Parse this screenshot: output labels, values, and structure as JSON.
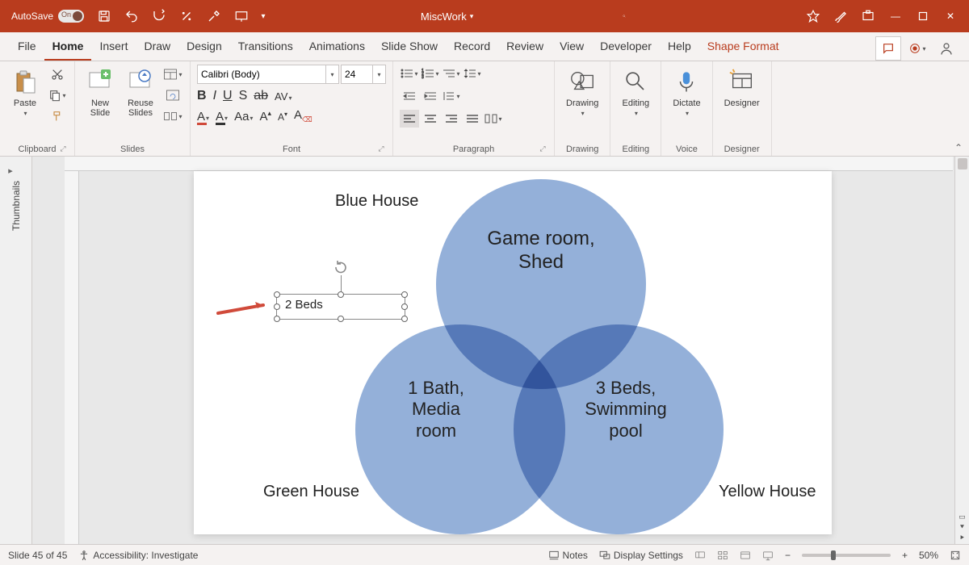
{
  "titlebar": {
    "autosave_label": "AutoSave",
    "autosave_state": "On",
    "doc_name": "MiscWork"
  },
  "tabs": {
    "file": "File",
    "home": "Home",
    "insert": "Insert",
    "draw": "Draw",
    "design": "Design",
    "transitions": "Transitions",
    "animations": "Animations",
    "slideshow": "Slide Show",
    "record": "Record",
    "review": "Review",
    "view": "View",
    "developer": "Developer",
    "help": "Help",
    "shape_format": "Shape Format"
  },
  "ribbon": {
    "clipboard": {
      "paste": "Paste",
      "label": "Clipboard"
    },
    "slides": {
      "new_slide": "New\nSlide",
      "reuse": "Reuse\nSlides",
      "label": "Slides"
    },
    "font": {
      "name": "Calibri (Body)",
      "size": "24",
      "label": "Font"
    },
    "paragraph": {
      "label": "Paragraph"
    },
    "drawing": {
      "btn": "Drawing",
      "label": "Drawing"
    },
    "editing": {
      "btn": "Editing",
      "label": "Editing"
    },
    "voice": {
      "btn": "Dictate",
      "label": "Voice"
    },
    "designer": {
      "btn": "Designer",
      "label": "Designer"
    }
  },
  "thumbnails_label": "Thumbnails",
  "chart_data": {
    "type": "venn",
    "sets": [
      {
        "name": "Blue House",
        "items": [
          "Game room",
          "Shed"
        ]
      },
      {
        "name": "Green House",
        "items": [
          "1 Bath",
          "Media room"
        ]
      },
      {
        "name": "Yellow House",
        "items": [
          "3 Beds",
          "Swimming pool"
        ]
      }
    ],
    "labels": {
      "top": "Game room,\nShed",
      "left": "1 Bath,\nMedia\nroom",
      "right": "3 Beds,\nSwimming\npool",
      "outer_top": "Blue House",
      "outer_left": "Green House",
      "outer_right": "Yellow House"
    },
    "selected_textbox": "2 Beds"
  },
  "statusbar": {
    "slide_info": "Slide 45 of 45",
    "accessibility": "Accessibility: Investigate",
    "notes": "Notes",
    "display": "Display Settings",
    "zoom": "50%"
  }
}
